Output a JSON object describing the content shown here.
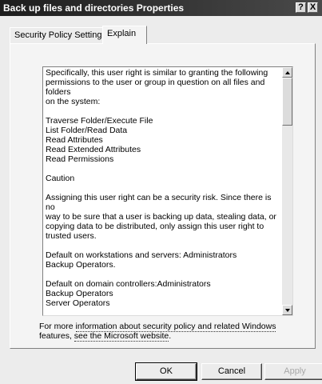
{
  "window": {
    "title": "Back up files and directories Properties",
    "help_glyph": "?",
    "close_glyph": "X"
  },
  "tabs": [
    {
      "label": "Security Policy Setting"
    },
    {
      "label": "Explain"
    }
  ],
  "explain": {
    "lines": [
      "Specifically, this user right is similar to granting the following",
      "permissions to the user or group in question on all files and folders",
      "on the system:",
      "",
      "Traverse Folder/Execute File",
      "List Folder/Read Data",
      "Read Attributes",
      "Read Extended Attributes",
      "Read Permissions",
      "",
      "Caution",
      "",
      "Assigning this user right can be a security risk. Since there is no",
      "way to be sure that a user is backing up data, stealing data, or",
      "copying data to be distributed, only assign this user right to",
      "trusted users.",
      "",
      "Default on workstations and servers: Administrators",
      "Backup Operators.",
      "",
      "Default on domain controllers:Administrators",
      "Backup Operators",
      "Server Operators"
    ]
  },
  "footer": {
    "prefix": "For more ",
    "link1": "information about security policy and related Windows",
    "line2_prefix": "features, ",
    "link2": "see the Microsoft website",
    "suffix": "."
  },
  "buttons": {
    "ok": "OK",
    "cancel": "Cancel",
    "apply": "Apply"
  }
}
